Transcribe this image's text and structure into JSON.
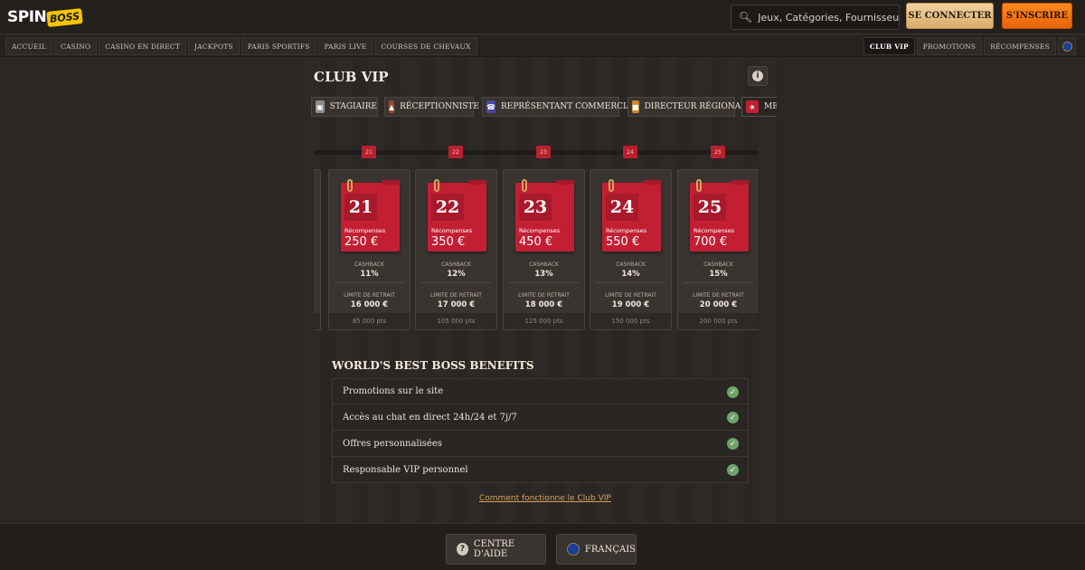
{
  "header": {
    "logo_spin": "SPIN",
    "logo_boss": "BOSS",
    "search_placeholder": "Jeux, Catégories, Fournisseurs",
    "login_label": "SE CONNECTER",
    "signup_label": "S'INSCRIRE"
  },
  "nav": {
    "left": [
      "ACCUEIL",
      "CASINO",
      "CASINO EN DIRECT",
      "JACKPOTS",
      "PARIS SPORTIFS",
      "PARIS LIVE",
      "COURSES DE CHEVAUX"
    ],
    "right": [
      "CLUB VIP",
      "PROMOTIONS",
      "RÉCOMPENSES"
    ],
    "active": "CLUB VIP"
  },
  "page": {
    "title": "CLUB VIP",
    "info_icon": "i"
  },
  "tiers": [
    {
      "label": "STAGIAIRE",
      "icon": "paper-icon",
      "color": "#8d8d8d"
    },
    {
      "label": "RÉCEPTIONNISTE",
      "icon": "bell-icon",
      "color": "#9b4a2a"
    },
    {
      "label": "REPRÉSENTANT COMMERCIAL",
      "icon": "phone-icon",
      "color": "#4a4aa0"
    },
    {
      "label": "DIRECTEUR RÉGIONAL",
      "icon": "folder-icon",
      "color": "#c9882e"
    },
    {
      "label": "MEI",
      "icon": "star-icon",
      "color": "#c21f33"
    }
  ],
  "markers": [
    "21",
    "22",
    "23",
    "24",
    "25"
  ],
  "levels": [
    {
      "level": "21",
      "reward_label": "Récompenses",
      "reward": "250 €",
      "cashback_label": "CASHBACK",
      "cashback": "11%",
      "limit_label": "LIMITE DE RETRAIT",
      "limit": "16 000 €",
      "points": "85 000 pts"
    },
    {
      "level": "22",
      "reward_label": "Récompenses",
      "reward": "350 €",
      "cashback_label": "CASHBACK",
      "cashback": "12%",
      "limit_label": "LIMITE DE RETRAIT",
      "limit": "17 000 €",
      "points": "105 000 pts"
    },
    {
      "level": "23",
      "reward_label": "Récompenses",
      "reward": "450 €",
      "cashback_label": "CASHBACK",
      "cashback": "13%",
      "limit_label": "LIMITE DE RETRAIT",
      "limit": "18 000 €",
      "points": "125 000 pts"
    },
    {
      "level": "24",
      "reward_label": "Récompenses",
      "reward": "550 €",
      "cashback_label": "CASHBACK",
      "cashback": "14%",
      "limit_label": "LIMITE DE RETRAIT",
      "limit": "19 000 €",
      "points": "150 000 pts"
    },
    {
      "level": "25",
      "reward_label": "Récompenses",
      "reward": "700 €",
      "cashback_label": "CASHBACK",
      "cashback": "15%",
      "limit_label": "LIMITE DE RETRAIT",
      "limit": "20 000 €",
      "points": "200 000 pts"
    }
  ],
  "benefits": {
    "title": "WORLD'S BEST BOSS BENEFITS",
    "items": [
      "Promotions sur le site",
      "Accès au chat en direct 24h/24 et 7j/7",
      "Offres personnalisées",
      "Responsable VIP personnel"
    ]
  },
  "how_link": "Comment fonctionne le Club VIP",
  "footer": {
    "help_label": "CENTRE D'AIDE",
    "language_label": "FRANÇAIS"
  },
  "colors": {
    "accent_orange": "#e8620a",
    "accent_gold": "#d9ad6c",
    "level_red": "#c21f33",
    "check_green": "#6fa36a"
  }
}
